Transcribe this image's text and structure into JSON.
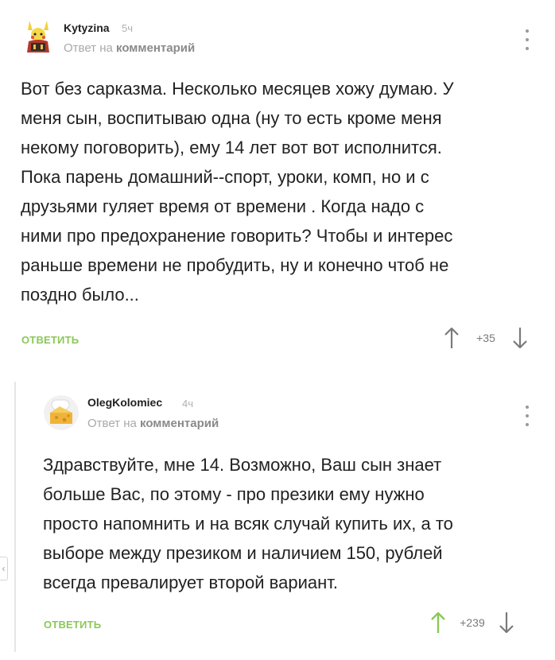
{
  "comments": [
    {
      "username": "Kytyzina",
      "time": "5ч",
      "reply_to_prefix": "Ответ на",
      "reply_to_target": "комментарий",
      "text": "Вот без сарказма. Несколько месяцев хожу думаю. У\nменя сын, воспитываю одна (ну то есть кроме меня\nнекому поговорить), ему 14 лет вот вот исполнится.\nПока парень домашний--спорт, уроки, комп, но и с\nдрузьями гуляет время от времени . Когда надо с\nними про предохранение говорить? Чтобы и интерес\nраньше времени не пробудить, ну и конечно чтоб не\nпоздно было...",
      "reply_label": "ОТВЕТИТЬ",
      "score": "+35",
      "upvote_active": false
    },
    {
      "username": "OlegKolomiec",
      "time": "4ч",
      "reply_to_prefix": "Ответ на",
      "reply_to_target": "комментарий",
      "text": "Здравствуйте, мне 14. Возможно, Ваш сын знает\nбольше Вас, по этому - про презики ему нужно\nпросто напомнить и на всяк случай купить их, а то\nвыборе между презиком и наличием 150, рублей\nвсегда превалирует второй вариант.",
      "reply_label": "ОТВЕТИТЬ",
      "score": "+239",
      "upvote_active": true
    }
  ],
  "colors": {
    "accent_green": "#8ac858",
    "arrow_gray": "#7a7a7a",
    "muted_text": "#a9a9a9"
  },
  "icons": {
    "more": "kebab-menu-icon",
    "upvote": "arrow-up-icon",
    "downvote": "arrow-down-icon",
    "collapse": "collapse-thread-icon"
  }
}
